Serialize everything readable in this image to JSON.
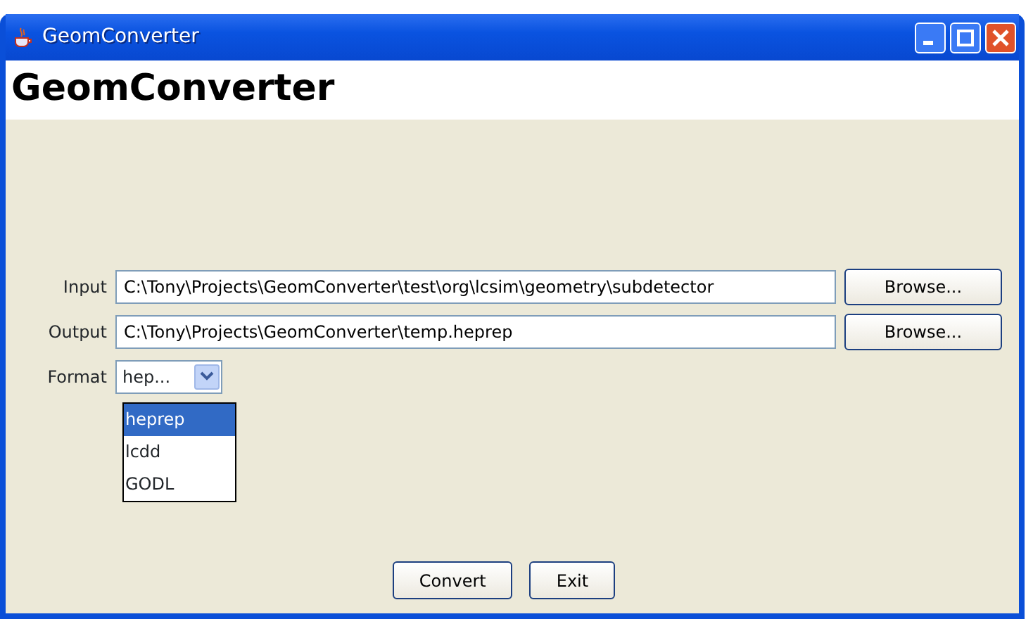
{
  "window": {
    "title": "GeomConverter"
  },
  "header": "GeomConverter",
  "fields": [
    {
      "label": "Input",
      "value": "C:\\Tony\\Projects\\GeomConverter\\test\\org\\lcsim\\geometry\\subdetector",
      "button": "Browse..."
    },
    {
      "label": "Output",
      "value": "C:\\Tony\\Projects\\GeomConverter\\temp.heprep",
      "button": "Browse..."
    }
  ],
  "format": {
    "label": "Format",
    "value": "hep...",
    "expanded": true,
    "options": [
      {
        "label": "heprep",
        "selected": true
      },
      {
        "label": "lcdd",
        "selected": false
      },
      {
        "label": "GODL",
        "selected": false
      }
    ]
  },
  "buttons": [
    "Convert",
    "Exit"
  ]
}
